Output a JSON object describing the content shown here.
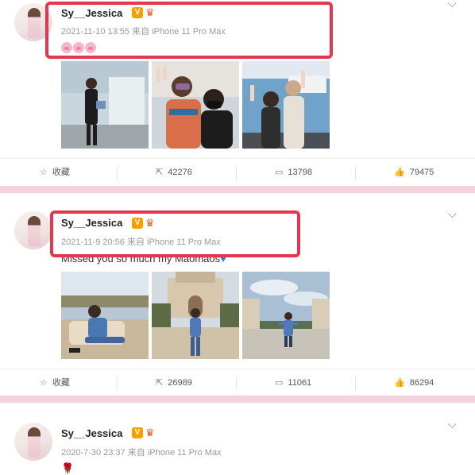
{
  "posts": [
    {
      "author": "Sy__Jessica",
      "verified_badge": "V",
      "crown_icon": "crown-icon",
      "meta": "2021-11-10 13:55 来自 iPhone 11 Pro Max",
      "text": "",
      "emoji_count": 3,
      "actions": {
        "favorite": "收藏",
        "repost": "42276",
        "comment": "13798",
        "like": "79475"
      }
    },
    {
      "author": "Sy__Jessica",
      "verified_badge": "V",
      "crown_icon": "crown-icon",
      "meta": "2021-11-9 20:56 来自 iPhone 11 Pro Max",
      "text": "Missed you so much my Maomaos",
      "actions": {
        "favorite": "收藏",
        "repost": "26989",
        "comment": "11061",
        "like": "86294"
      }
    },
    {
      "author": "Sy__Jessica",
      "verified_badge": "V",
      "crown_icon": "crown-icon",
      "meta": "2020-7-30 23:37 来自 iPhone 11 Pro Max",
      "text": "🌹"
    }
  ],
  "colors": {
    "highlight": "#e5364f",
    "separator": "#f6d3dc",
    "badge": "#f5a000"
  }
}
